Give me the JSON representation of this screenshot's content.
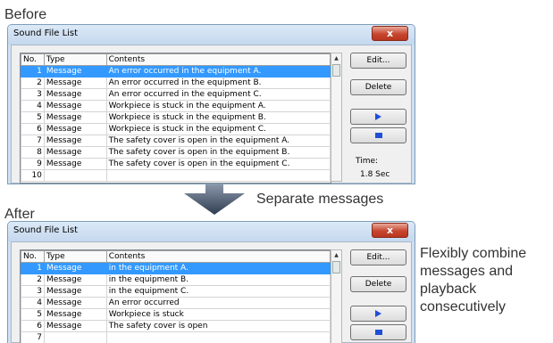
{
  "captions": {
    "before": "Before",
    "after": "After",
    "separate": "Separate messages",
    "side_note": "Flexibly combine messages and playback consecutively"
  },
  "before_window": {
    "title": "Sound File List",
    "close_symbol": "x",
    "columns": {
      "no": "No.",
      "type": "Type",
      "contents": "Contents"
    },
    "rows": [
      {
        "no": "1",
        "type": "Message",
        "contents": "An error occurred in the equipment A.",
        "selected": true
      },
      {
        "no": "2",
        "type": "Message",
        "contents": "An error occurred in the equipment B."
      },
      {
        "no": "3",
        "type": "Message",
        "contents": "An error occurred in the equipment C."
      },
      {
        "no": "4",
        "type": "Message",
        "contents": "Workpiece is stuck in the equipment A."
      },
      {
        "no": "5",
        "type": "Message",
        "contents": "Workpiece is stuck in the equipment B."
      },
      {
        "no": "6",
        "type": "Message",
        "contents": "Workpiece is stuck in the equipment C."
      },
      {
        "no": "7",
        "type": "Message",
        "contents": "The safety cover is open in the equipment A."
      },
      {
        "no": "8",
        "type": "Message",
        "contents": "The safety cover is open in the equipment B."
      },
      {
        "no": "9",
        "type": "Message",
        "contents": "The safety cover is open in the equipment C."
      },
      {
        "no": "10",
        "type": "",
        "contents": ""
      }
    ],
    "buttons": {
      "edit": "Edit...",
      "delete": "Delete",
      "play_icon": "play-icon",
      "stop_icon": "stop-icon"
    },
    "time_label": "Time:",
    "time_value": "1.8 Sec"
  },
  "after_window": {
    "title": "Sound File List",
    "close_symbol": "x",
    "columns": {
      "no": "No.",
      "type": "Type",
      "contents": "Contents"
    },
    "rows": [
      {
        "no": "1",
        "type": "Message",
        "contents": "in the equipment A.",
        "selected": true
      },
      {
        "no": "2",
        "type": "Message",
        "contents": "in the equipment B."
      },
      {
        "no": "3",
        "type": "Message",
        "contents": "in the equipment C."
      },
      {
        "no": "4",
        "type": "Message",
        "contents": "An error occurred"
      },
      {
        "no": "5",
        "type": "Message",
        "contents": "Workpiece is stuck"
      },
      {
        "no": "6",
        "type": "Message",
        "contents": "The safety cover is open"
      },
      {
        "no": "7",
        "type": "",
        "contents": ""
      }
    ],
    "buttons": {
      "edit": "Edit...",
      "delete": "Delete",
      "play_icon": "play-icon",
      "stop_icon": "stop-icon"
    }
  },
  "colors": {
    "selection": "#3399ff",
    "close_button": "#c7462f",
    "arrow": "#4a5a70",
    "media_icon": "#1f4fd6"
  }
}
